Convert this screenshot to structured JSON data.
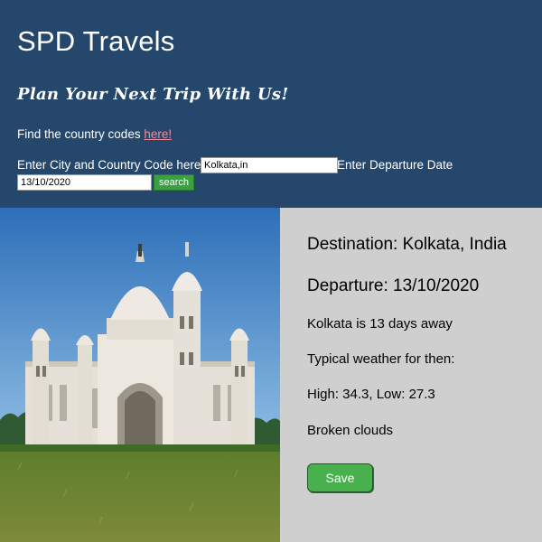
{
  "header": {
    "brand": "SPD Travels",
    "tagline": "Plan Your Next Trip With Us!",
    "find_prefix": "Find the country codes ",
    "find_link": "here!",
    "city_label": "Enter City and Country Code here",
    "city_value": "Kolkata,in",
    "date_label": "Enter Departure Date",
    "date_value": "13/10/2020",
    "search_label": "search"
  },
  "result": {
    "destination": "Destination: Kolkata, India",
    "departure": "Departure: 13/10/2020",
    "days_away": "Kolkata is 13 days away",
    "weather_heading": "Typical weather for then:",
    "temps": "High: 34.3, Low: 27.3",
    "conditions": "Broken clouds",
    "save_label": "Save"
  },
  "colors": {
    "header_bg": "#24476b",
    "info_bg": "#cfcfcf",
    "link": "#f28ba0",
    "button_green": "#3aa043"
  },
  "hero_image": "victoria-memorial-photo"
}
